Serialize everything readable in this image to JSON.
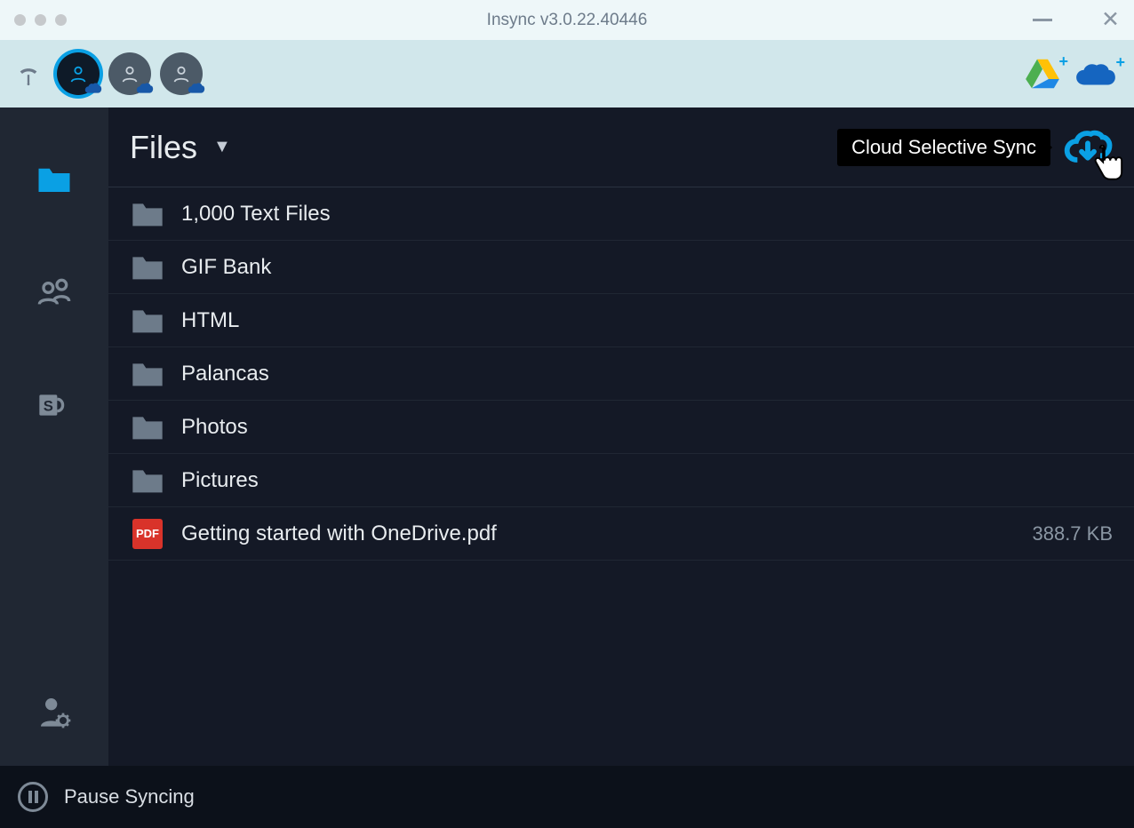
{
  "window": {
    "title": "Insync v3.0.22.40446"
  },
  "header": {
    "title": "Files",
    "tooltip": "Cloud Selective Sync"
  },
  "files": [
    {
      "name": "1,000 Text Files",
      "type": "folder",
      "size": ""
    },
    {
      "name": "GIF Bank",
      "type": "folder",
      "size": ""
    },
    {
      "name": "HTML",
      "type": "folder",
      "size": ""
    },
    {
      "name": "Palancas",
      "type": "folder",
      "size": ""
    },
    {
      "name": "Photos",
      "type": "folder",
      "size": ""
    },
    {
      "name": "Pictures",
      "type": "folder",
      "size": ""
    },
    {
      "name": "Getting started with OneDrive.pdf",
      "type": "pdf",
      "size": "388.7 KB"
    }
  ],
  "status": {
    "pause_label": "Pause Syncing"
  },
  "pdf_badge": "PDF"
}
